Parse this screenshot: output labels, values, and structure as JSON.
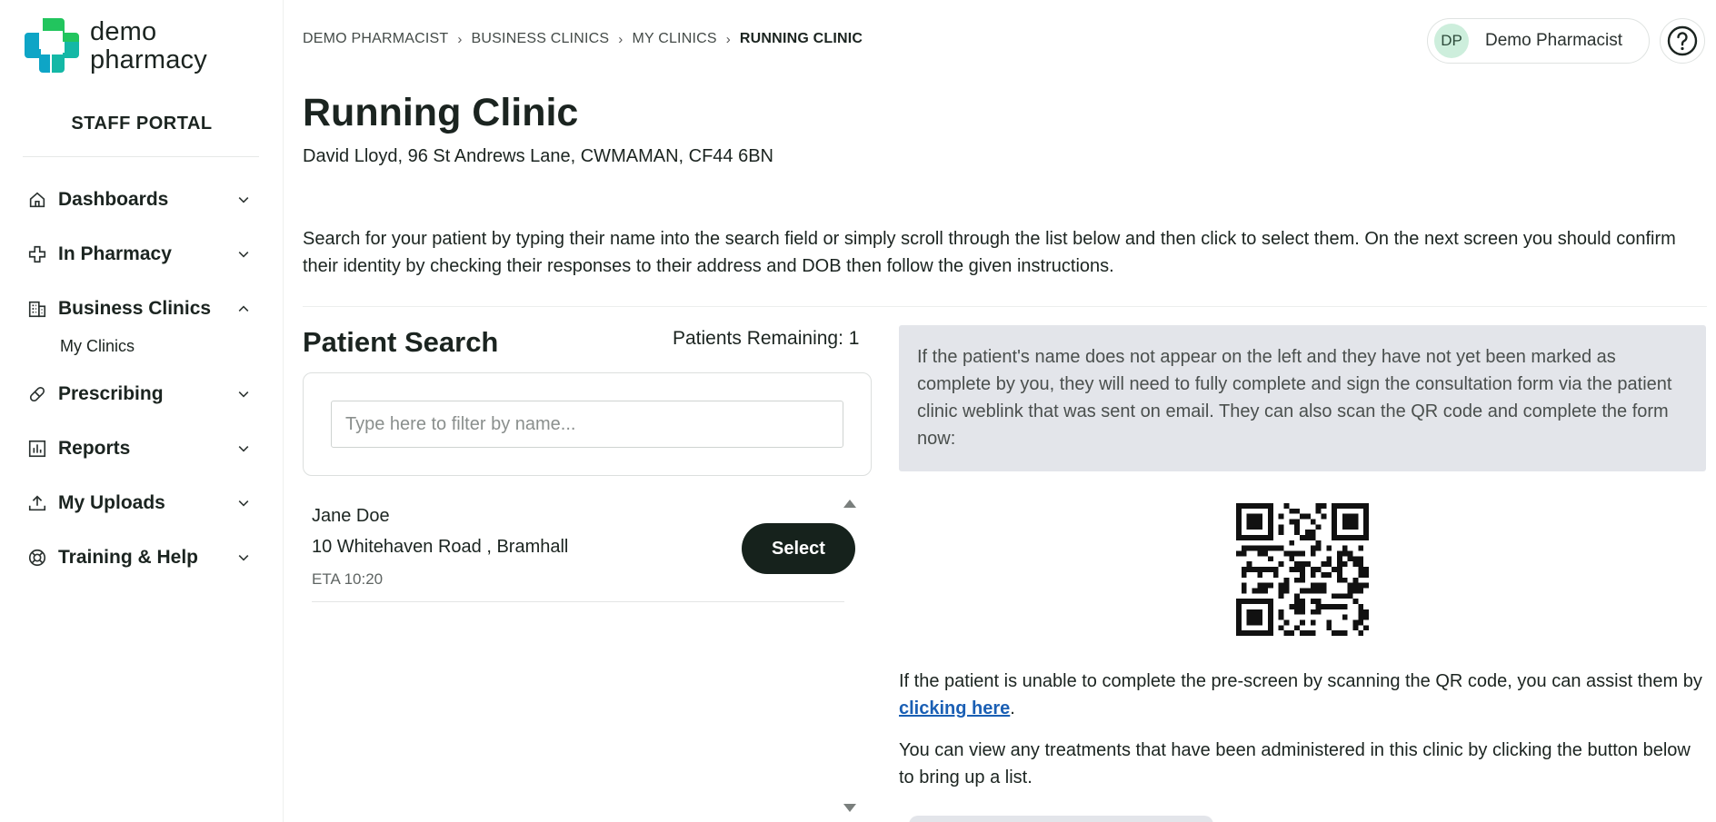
{
  "brand": {
    "logo_line1": "demo",
    "logo_line2": "pharmacy",
    "portal_title": "STAFF PORTAL",
    "accent_color": "#14b8a6",
    "accent_dark": "#0c7ab8"
  },
  "sidebar": {
    "items": [
      {
        "label": "Dashboards",
        "icon": "home-icon",
        "expanded": false
      },
      {
        "label": "In Pharmacy",
        "icon": "cross-icon",
        "expanded": false
      },
      {
        "label": "Business Clinics",
        "icon": "building-icon",
        "expanded": true,
        "sub": [
          "My Clinics"
        ]
      },
      {
        "label": "Prescribing",
        "icon": "pill-icon",
        "expanded": false
      },
      {
        "label": "Reports",
        "icon": "bar-chart-icon",
        "expanded": false
      },
      {
        "label": "My Uploads",
        "icon": "upload-icon",
        "expanded": false
      },
      {
        "label": "Training & Help",
        "icon": "lifebuoy-icon",
        "expanded": false
      }
    ]
  },
  "header": {
    "breadcrumb": [
      "DEMO PHARMACIST",
      "BUSINESS CLINICS",
      "MY CLINICS",
      "RUNNING CLINIC"
    ],
    "user_initials": "DP",
    "user_name": "Demo Pharmacist",
    "help_icon": "question-circle-icon"
  },
  "main": {
    "title": "Running Clinic",
    "address": "David Lloyd, 96 St Andrews Lane, CWMAMAN, CF44 6BN",
    "intro": "Search for your patient by typing their name into the search field or simply scroll through the list below and then click to select them. On the next screen you should confirm their identity by checking their responses to their address and DOB then follow the given instructions."
  },
  "patient_search": {
    "title": "Patient Search",
    "remaining": "Patients Remaining: 1",
    "placeholder": "Type here to filter by name...",
    "value": "",
    "patients": [
      {
        "name": "Jane Doe",
        "address": "10 Whitehaven Road , Bramhall",
        "eta": "ETA 10:20",
        "button": "Select"
      }
    ]
  },
  "info": {
    "notice": "If the patient's name does not appear on the left and they have not yet been marked as complete by you, they will need to fully complete and sign the consultation form via the patient clinic weblink that was sent on email. They can also scan the QR code and complete the form now:",
    "assist_prefix": "If the patient is unable to complete the pre-screen by scanning the QR code, you can assist them by ",
    "assist_link": "clicking here",
    "assist_suffix": ".",
    "treatments": "You can view any treatments that have been administered in this clinic by clicking the button below to bring up a list."
  }
}
